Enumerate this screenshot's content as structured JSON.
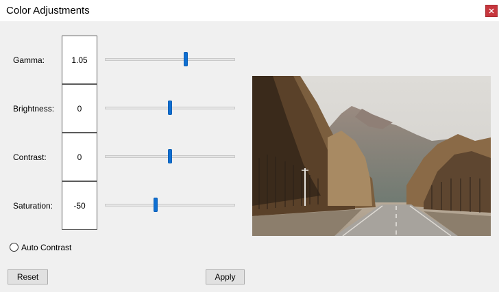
{
  "window": {
    "title": "Color Adjustments",
    "close_glyph": "✕"
  },
  "adjustments": [
    {
      "label": "Gamma:",
      "value": "1.05",
      "slider_position": 0.62
    },
    {
      "label": "Brightness:",
      "value": "0",
      "slider_position": 0.5
    },
    {
      "label": "Contrast:",
      "value": "0",
      "slider_position": 0.5
    },
    {
      "label": "Saturation:",
      "value": "-50",
      "slider_position": 0.39
    }
  ],
  "auto_contrast": {
    "label": "Auto Contrast",
    "checked": false
  },
  "buttons": {
    "reset": "Reset",
    "apply": "Apply"
  },
  "colors": {
    "accent": "#0f6fd1",
    "close": "#c7363d"
  }
}
